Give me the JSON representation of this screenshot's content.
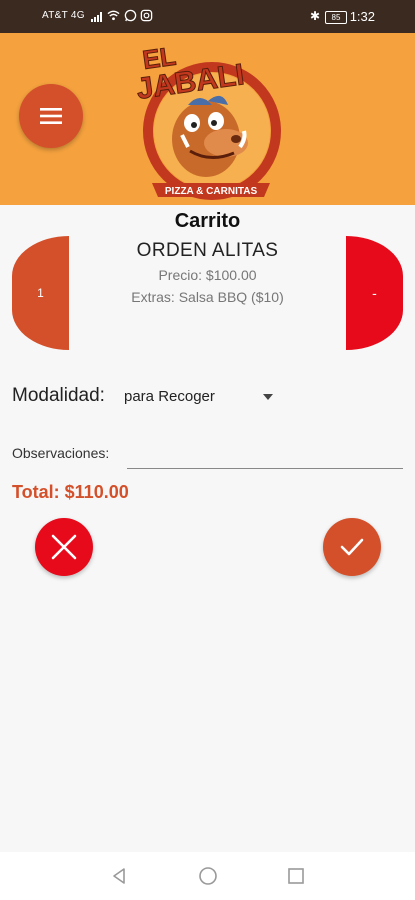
{
  "status_bar": {
    "carrier": "AT&T 4G",
    "battery": "85",
    "time": "1:32"
  },
  "header": {
    "logo_text_top": "EL",
    "logo_text_main": "JABALI",
    "logo_banner": "PIZZA & CARNITAS",
    "menu_icon": "hamburger-menu-icon"
  },
  "cart": {
    "title": "Carrito",
    "item": {
      "name": "ORDEN ALITAS",
      "quantity": "1",
      "price": "Precio: $100.00",
      "extras": "Extras: Salsa BBQ ($10)",
      "remove_label": "-"
    },
    "modality": {
      "label": "Modalidad:",
      "selected": "para Recoger"
    },
    "observations": {
      "label": "Observaciones:",
      "value": ""
    },
    "total": "Total: $110.00"
  },
  "actions": {
    "cancel_icon": "close-icon",
    "confirm_icon": "check-icon"
  },
  "colors": {
    "header_bg": "#f4a13e",
    "accent": "#d4502a",
    "danger": "#e60a1a",
    "status_bar": "#3a2a20"
  }
}
